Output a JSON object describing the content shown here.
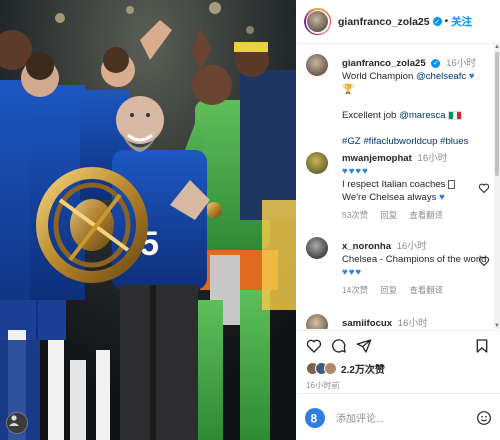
{
  "post": {
    "username": "gianfranco_zola25",
    "follow_label": "关注",
    "caption_time": "16小时",
    "caption_line1": "World Champion",
    "caption_mention": "@chelseafc",
    "caption_line2": "Excellent job",
    "caption_mention2": "@maresca",
    "caption_tags": "#GZ #fifaclubworldcup #blues",
    "likes": "2.2万次赞",
    "posted_ago": "16小时前",
    "add_comment_placeholder": "添加评论..."
  },
  "comments": [
    {
      "username": "mwanjemophat",
      "time": "16小时",
      "text_line1": "I respect Italian coaches",
      "text_line2": "We're Chelsea always",
      "likes": "53次赞",
      "reply": "回复",
      "translate": "查看翻译"
    },
    {
      "username": "x_noronha",
      "time": "16小时",
      "text": "Chelsea - Champions of the world",
      "likes": "14次赞",
      "reply": "回复",
      "translate": "查看翻译"
    },
    {
      "username": "samiifocux",
      "time": "16小时"
    }
  ],
  "photo": {
    "jersey_number": "5"
  },
  "colors": {
    "link": "#00376b",
    "brand_blue": "#0095f6",
    "chelsea_blue": "#1447a6",
    "keeper_green": "#4caf50"
  }
}
